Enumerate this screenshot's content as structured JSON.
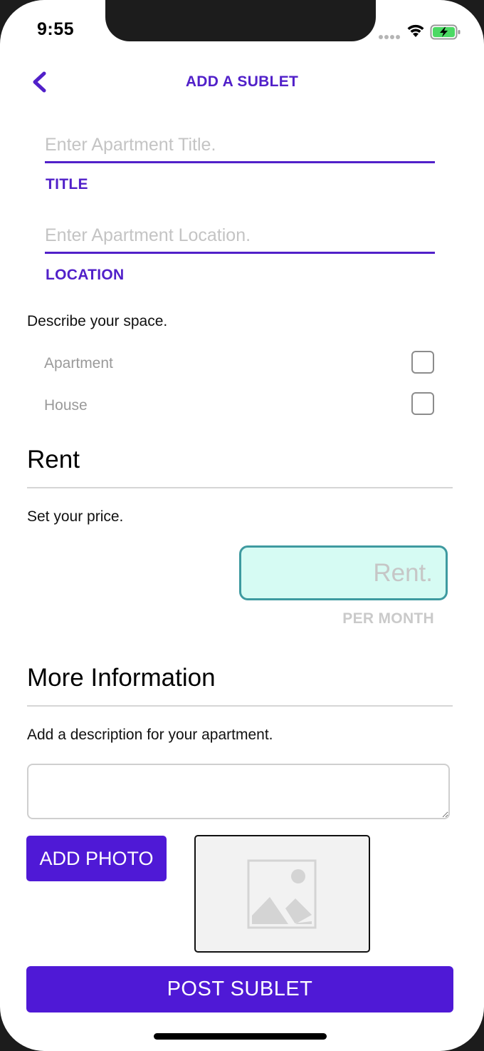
{
  "status_bar": {
    "time": "9:55"
  },
  "nav": {
    "back_icon": "chevron-left-icon",
    "title": "ADD A SUBLET"
  },
  "title_field": {
    "placeholder": "Enter Apartment Title.",
    "value": "",
    "label": "TITLE"
  },
  "location_field": {
    "placeholder": "Enter Apartment Location.",
    "value": "",
    "label": "LOCATION"
  },
  "space": {
    "prompt": "Describe your space.",
    "options": [
      {
        "label": "Apartment",
        "checked": false
      },
      {
        "label": "House",
        "checked": false
      }
    ]
  },
  "rent": {
    "heading": "Rent",
    "prompt": "Set your price.",
    "placeholder": "Rent.",
    "value": "",
    "unit_label": "PER MONTH"
  },
  "more_info": {
    "heading": "More Information",
    "prompt": "Add a description for your apartment.",
    "description_value": ""
  },
  "photo": {
    "button_label": "ADD PHOTO",
    "placeholder_icon": "image-placeholder-icon"
  },
  "submit": {
    "label": "POST SUBLET"
  },
  "colors": {
    "accent": "#5120c9",
    "button": "#4f19d6",
    "rent_border": "#3e9aa0",
    "rent_fill": "#d6fbf3"
  }
}
